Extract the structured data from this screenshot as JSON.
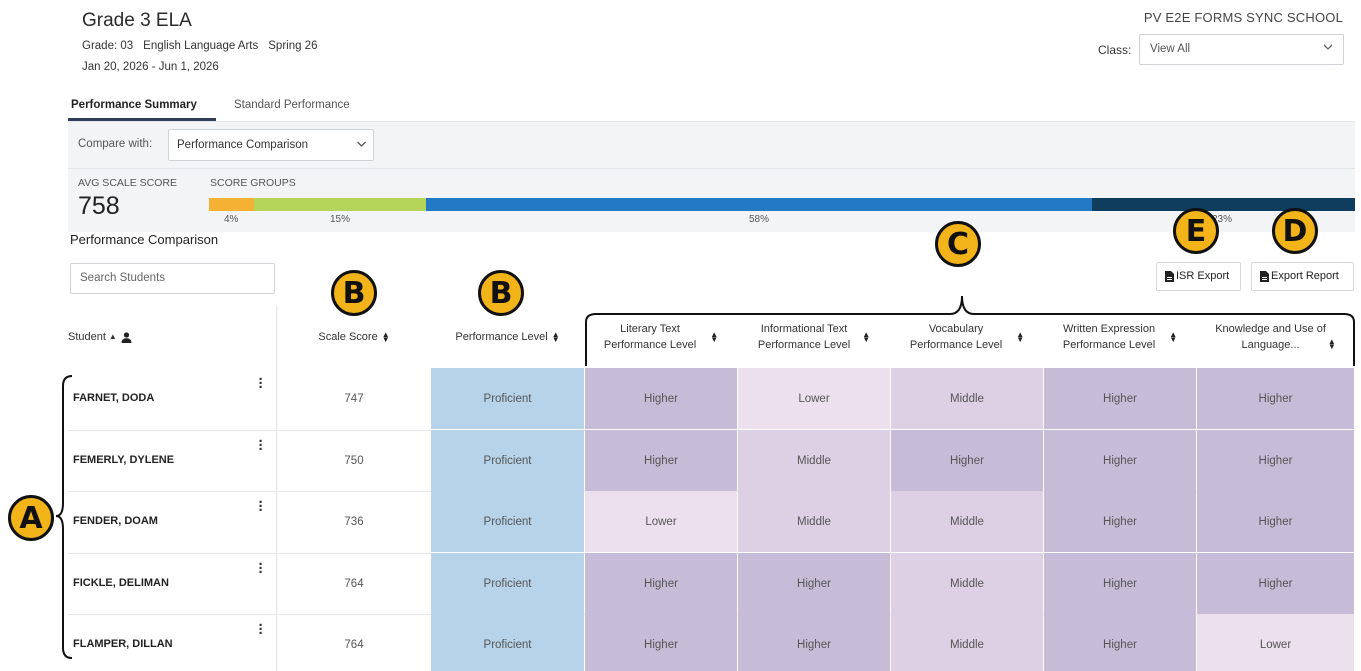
{
  "header": {
    "title": "Grade 3 ELA",
    "grade": "Grade: 03",
    "subject": "English Language Arts",
    "term": "Spring 26",
    "dates": "Jan 20, 2026 - Jun 1, 2026",
    "school": "PV E2E FORMS SYNC SCHOOL",
    "class_label": "Class:",
    "class_value": "View All"
  },
  "tabs": [
    {
      "label": "Performance Summary",
      "active": true
    },
    {
      "label": "Standard Performance",
      "active": false
    }
  ],
  "compare": {
    "label": "Compare with:",
    "value": "Performance Comparison"
  },
  "summary": {
    "avg_label": "AVG SCALE SCORE",
    "avg_value": "758",
    "groups_label": "SCORE GROUPS",
    "groups": [
      {
        "pct": 4,
        "label": "4%",
        "color": "#f5b133"
      },
      {
        "pct": 15,
        "label": "15%",
        "color": "#b5d45a"
      },
      {
        "pct": 58,
        "label": "58%",
        "color": "#2479c4"
      },
      {
        "pct": 23,
        "label": "23%",
        "color": "#0e3d5e"
      }
    ]
  },
  "section_title": "Performance Comparison",
  "search_placeholder": "Search Students",
  "buttons": {
    "isr_export": "ISR Export",
    "export_report": "Export Report"
  },
  "callouts": {
    "a": "A",
    "b": "B",
    "c": "C",
    "d": "D",
    "e": "E"
  },
  "table": {
    "headers": {
      "student": "Student",
      "scale_score": "Scale Score",
      "performance_level": "Performance Level",
      "lit_1": "Literary Text",
      "lit_2": "Performance Level",
      "info_1": "Informational Text",
      "info_2": "Performance Level",
      "vocab_1": "Vocabulary",
      "vocab_2": "Performance Level",
      "written_1": "Written Expression",
      "written_2": "Performance Level",
      "know_1": "Knowledge and Use of",
      "know_2": "Language..."
    },
    "rows": [
      {
        "name": "FARNET, DODA",
        "score": "747",
        "level": "Proficient",
        "lit": "Higher",
        "info": "Lower",
        "vocab": "Middle",
        "written": "Higher",
        "know": "Higher"
      },
      {
        "name": "FEMERLY, DYLENE",
        "score": "750",
        "level": "Proficient",
        "lit": "Higher",
        "info": "Middle",
        "vocab": "Higher",
        "written": "Higher",
        "know": "Higher"
      },
      {
        "name": "FENDER, DOAM",
        "score": "736",
        "level": "Proficient",
        "lit": "Lower",
        "info": "Middle",
        "vocab": "Middle",
        "written": "Higher",
        "know": "Higher"
      },
      {
        "name": "FICKLE, DELIMAN",
        "score": "764",
        "level": "Proficient",
        "lit": "Higher",
        "info": "Higher",
        "vocab": "Middle",
        "written": "Higher",
        "know": "Higher"
      },
      {
        "name": "FLAMPER, DILLAN",
        "score": "764",
        "level": "Proficient",
        "lit": "Higher",
        "info": "Higher",
        "vocab": "Middle",
        "written": "Higher",
        "know": "Lower"
      }
    ]
  },
  "colors": {
    "proficient": "#b7d3e9",
    "higher": "#c7bcd8",
    "middle": "#ddd0e5",
    "lower": "#ece0ee"
  }
}
